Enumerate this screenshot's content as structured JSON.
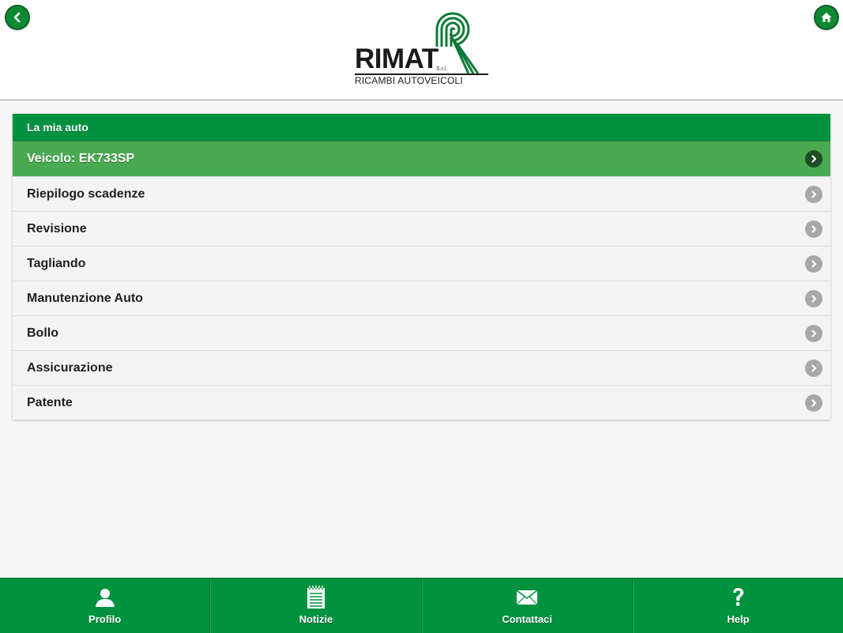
{
  "header": {
    "back_icon": "chevron-left-icon",
    "home_icon": "home-icon",
    "logo": {
      "name": "RIMAT",
      "suffix": "S.r.l.",
      "tagline": "RICAMBI AUTOVEICOLI"
    }
  },
  "colors": {
    "brand_green": "#00923f",
    "active_row": "#4aaa52",
    "chevron_gray": "#a8a8a8",
    "background": "#f7f7f7"
  },
  "panel": {
    "title": "La mia auto",
    "items": [
      {
        "label": "Veicolo: EK733SP",
        "active": true
      },
      {
        "label": "Riepilogo scadenze"
      },
      {
        "label": "Revisione"
      },
      {
        "label": "Tagliando"
      },
      {
        "label": "Manutenzione Auto"
      },
      {
        "label": "Bollo"
      },
      {
        "label": "Assicurazione"
      },
      {
        "label": "Patente"
      }
    ]
  },
  "tabbar": {
    "tabs": [
      {
        "label": "Profilo",
        "icon": "user-icon"
      },
      {
        "label": "Notizie",
        "icon": "notepad-icon"
      },
      {
        "label": "Contattaci",
        "icon": "envelope-icon"
      },
      {
        "label": "Help",
        "icon": "question-icon"
      }
    ]
  }
}
